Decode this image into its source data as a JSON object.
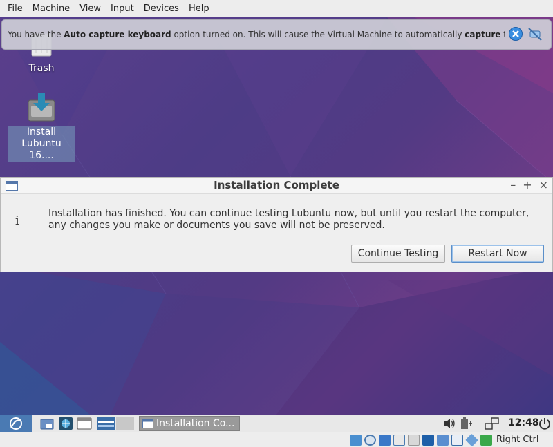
{
  "host_menu": {
    "items": [
      "File",
      "Machine",
      "View",
      "Input",
      "Devices",
      "Help"
    ]
  },
  "notification": {
    "text_1": "You have the ",
    "text_bold_1": "Auto capture keyboard",
    "text_2": " option turned on. This will cause the Virtual Machine to automatically ",
    "text_bold_2": "capture",
    "text_3": " the"
  },
  "desktop": {
    "icons": [
      {
        "label": "Trash"
      },
      {
        "label": "Install Lubuntu 16...."
      }
    ]
  },
  "dialog": {
    "title": "Installation Complete",
    "info_glyph": "i",
    "message": "Installation has finished.  You can continue testing Lubuntu now, but until you restart the computer, any changes you make or documents you save will not be preserved.",
    "continue_label": "Continue Testing",
    "restart_label": "Restart Now",
    "wm_minimize": "–",
    "wm_maximize": "+",
    "wm_close": "×"
  },
  "panel": {
    "task_label": "Installation Co...",
    "clock": "12:48"
  },
  "statusbar": {
    "host_key": "Right Ctrl"
  },
  "colors": {
    "desktop_accent": "#5b3f8c",
    "panel_menu": "#4a7ab3",
    "default_button_border": "#5b8fc9"
  }
}
